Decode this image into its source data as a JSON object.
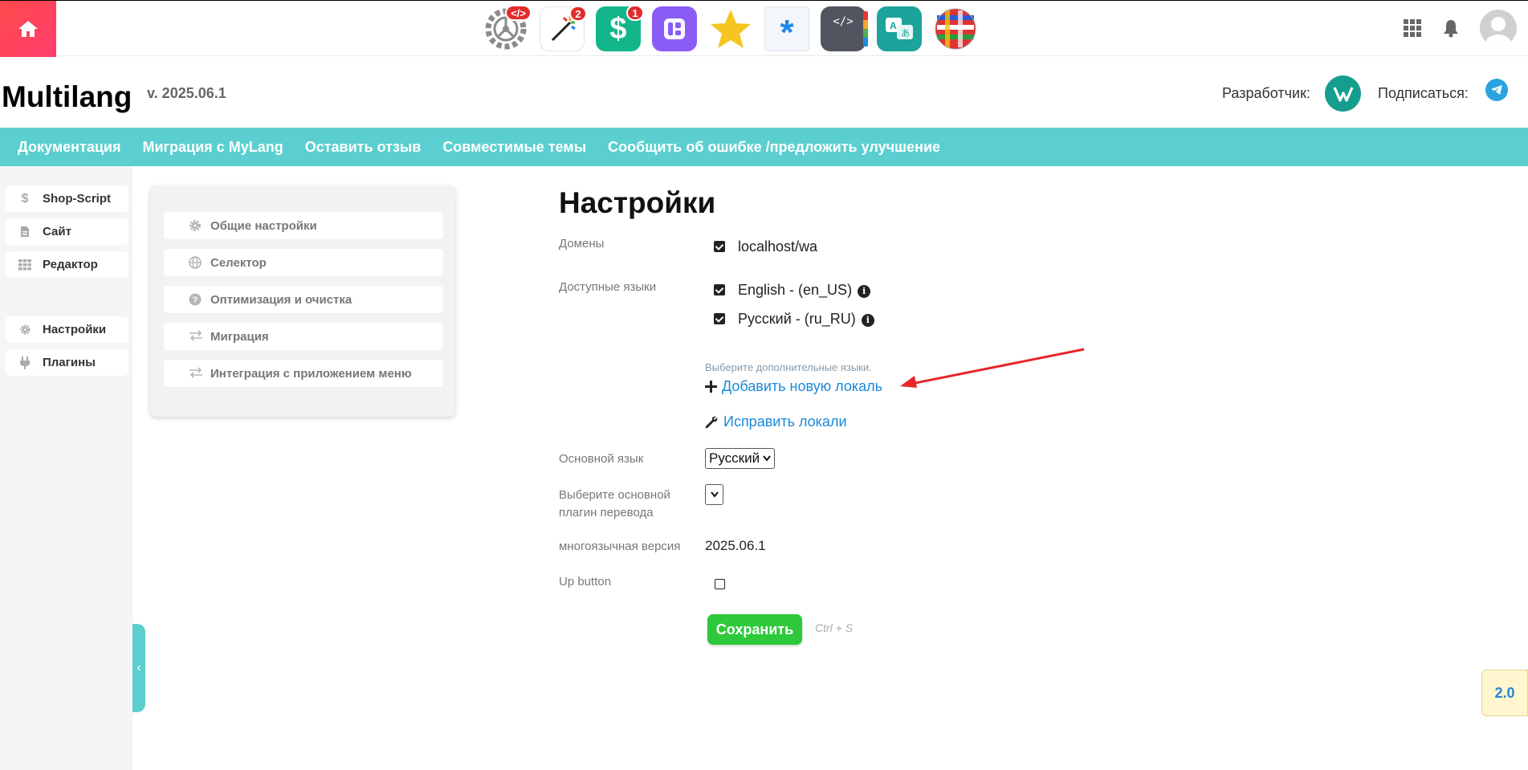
{
  "topbar": {
    "apps": [
      {
        "name": "developer-app",
        "badge": "</>"
      },
      {
        "name": "design-app",
        "badge": "2"
      },
      {
        "name": "shop-app",
        "badge": "1"
      },
      {
        "name": "site-app",
        "badge": ""
      },
      {
        "name": "favorites-app",
        "badge": ""
      },
      {
        "name": "asterisk-app",
        "badge": ""
      },
      {
        "name": "code-app",
        "badge": ""
      },
      {
        "name": "translate-app",
        "badge": ""
      },
      {
        "name": "flags-app",
        "badge": ""
      }
    ]
  },
  "header": {
    "title": "Multilang",
    "version": "v. 2025.06.1",
    "developer_label": "Разработчик:",
    "subscribe_label": "Подписаться:"
  },
  "nav": {
    "items": [
      "Документация",
      "Миграция с MyLang",
      "Оставить отзыв",
      "Совместимые темы",
      "Сообщить об ошибке /предложить улучшение"
    ]
  },
  "sidebar": {
    "items_top": [
      "Shop-Script",
      "Сайт",
      "Редактор"
    ],
    "items_bottom": [
      "Настройки",
      "Плагины"
    ]
  },
  "settings_menu": {
    "items": [
      "Общие настройки",
      "Селектор",
      "Оптимизация и очистка",
      "Миграция",
      "Интеграция с приложением меню"
    ]
  },
  "main": {
    "title": "Настройки",
    "domains_label": "Домены",
    "domain_value": "localhost/wa",
    "languages_label": "Доступные языки",
    "languages": [
      "English - (en_US)",
      "Русский - (ru_RU)"
    ],
    "hint": "Выберите дополнительные языки.",
    "add_locale": "Добавить новую локаль",
    "fix_locales": "Исправить локали",
    "main_language_label": "Основной язык",
    "main_language_value": "Русский",
    "translate_plugin_label_1": "Выберите основной",
    "translate_plugin_label_2": "плагин перевода",
    "ml_version_label": "многоязычная версия",
    "ml_version_value": "2025.06.1",
    "up_button_label": "Up button",
    "save": "Сохранить",
    "shortcut": "Ctrl + S"
  },
  "floating_version": "2.0",
  "colors": {
    "accent": "#5bcfcf",
    "save": "#2ec93b",
    "link": "#1a8ad8",
    "home": "#ff4a4a"
  }
}
